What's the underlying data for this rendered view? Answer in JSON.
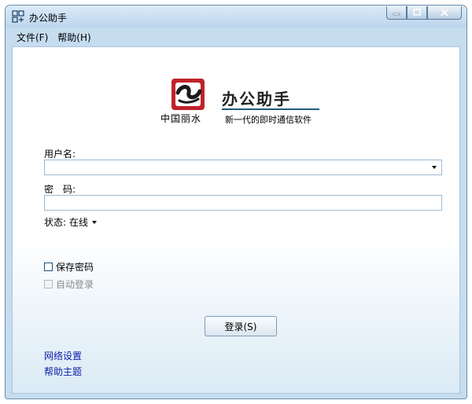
{
  "window": {
    "title": "办公助手",
    "accent_color": "#c6ddf0",
    "controls": [
      "minimize-icon",
      "maximize-icon",
      "close-icon"
    ]
  },
  "menu": {
    "items": [
      {
        "label": "文件(F)"
      },
      {
        "label": "帮助(H)"
      }
    ]
  },
  "logo": {
    "caption": "中国丽水",
    "brand": "办公助手",
    "slogan": "新一代的即时通信软件"
  },
  "form": {
    "username_label": "用户名:",
    "username_value": "",
    "password_label": "密　码:",
    "password_value": "",
    "status_label": "状态:",
    "status_value": "在线",
    "save_password_label": "保存密码",
    "save_password_checked": false,
    "auto_login_label": "自动登录",
    "auto_login_checked": false,
    "auto_login_enabled": false,
    "login_button": "登录(S)"
  },
  "links": {
    "network_settings": "网络设置",
    "help_topics": "帮助主题"
  },
  "colors": {
    "link": "#0a1eaa",
    "brand_line": "#1c5b7f",
    "logo_red": "#c0222b"
  }
}
